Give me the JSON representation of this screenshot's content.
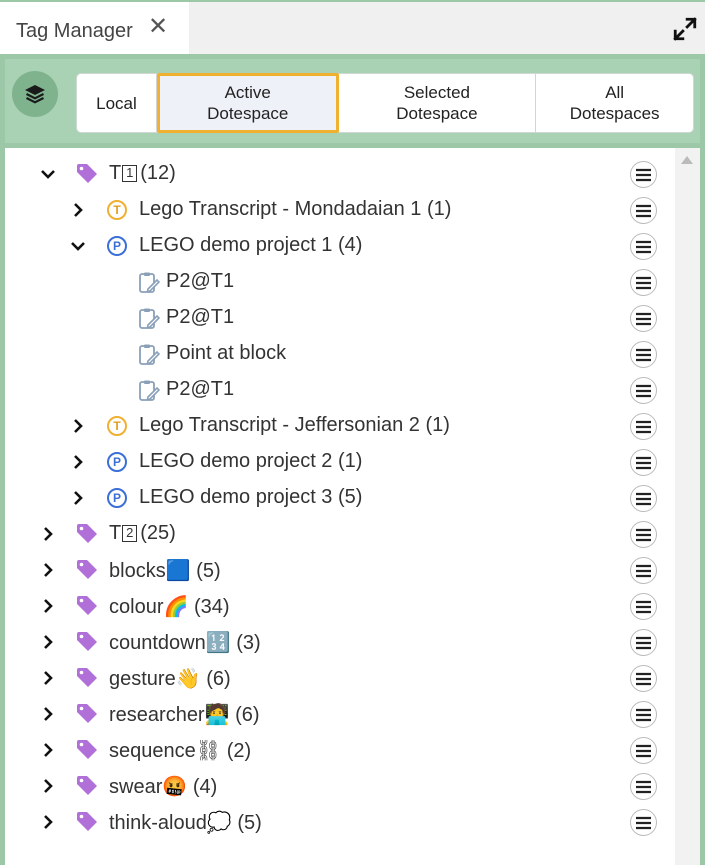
{
  "tab": {
    "title": "Tag Manager",
    "close_glyph": "✕"
  },
  "filter": {
    "options": [
      {
        "label": "Local"
      },
      {
        "label": "Active\nDotespace"
      },
      {
        "label": "Selected\nDotespace"
      },
      {
        "label": "All\nDotespaces"
      }
    ],
    "selected": "Active\nDotespace"
  },
  "tree": {
    "rows": [
      {
        "name": "T",
        "badge": "1",
        "count": "(12)",
        "state": "expanded",
        "icon": "tag-icon"
      },
      {
        "name": "Lego Transcript - Mondadaian 1 (1)",
        "state": "collapsed",
        "icon": "transcript-icon",
        "icon_glyph": "T"
      },
      {
        "name": "LEGO demo project 1 (4)",
        "state": "expanded",
        "icon": "project-icon",
        "icon_glyph": "P"
      },
      {
        "name": "P2@T1",
        "icon": "note-icon"
      },
      {
        "name": "P2@T1",
        "icon": "note-icon"
      },
      {
        "name": "Point at block",
        "icon": "note-icon"
      },
      {
        "name": "P2@T1",
        "icon": "note-icon"
      },
      {
        "name": "Lego Transcript - Jeffersonian 2 (1)",
        "state": "collapsed",
        "icon": "transcript-icon",
        "icon_glyph": "T"
      },
      {
        "name": "LEGO demo project 2 (1)",
        "state": "collapsed",
        "icon": "project-icon",
        "icon_glyph": "P"
      },
      {
        "name": "LEGO demo project 3 (5)",
        "state": "collapsed",
        "icon": "project-icon",
        "icon_glyph": "P"
      },
      {
        "name": "T",
        "badge": "2",
        "count": "(25)",
        "state": "collapsed",
        "icon": "tag-icon"
      },
      {
        "name": "blocks",
        "emoji": "🟦",
        "count": "(5)",
        "state": "collapsed",
        "icon": "tag-icon"
      },
      {
        "name": "colour",
        "emoji": "🌈",
        "count": "(34)",
        "state": "collapsed",
        "icon": "tag-icon"
      },
      {
        "name": "countdown",
        "emoji": "🔢",
        "count": "(3)",
        "state": "collapsed",
        "icon": "tag-icon"
      },
      {
        "name": "gesture",
        "emoji": "👋",
        "count": "(6)",
        "state": "collapsed",
        "icon": "tag-icon"
      },
      {
        "name": "researcher",
        "emoji": "🧑‍💻",
        "count": "(6)",
        "state": "collapsed",
        "icon": "tag-icon"
      },
      {
        "name": "sequence",
        "emoji": "⛓",
        "count": "(2)",
        "state": "collapsed",
        "icon": "tag-icon"
      },
      {
        "name": "swear",
        "emoji": "🤬",
        "count": "(4)",
        "state": "collapsed",
        "icon": "tag-icon"
      },
      {
        "name": "think-aloud",
        "emoji": "💭",
        "count": "(5)",
        "state": "collapsed",
        "icon": "tag-icon"
      }
    ]
  },
  "colors": {
    "accent_green": "#9cc8a8",
    "selected_border": "#f0b030",
    "tag_purple": "#b070d8",
    "project_blue": "#3b6fd6"
  }
}
